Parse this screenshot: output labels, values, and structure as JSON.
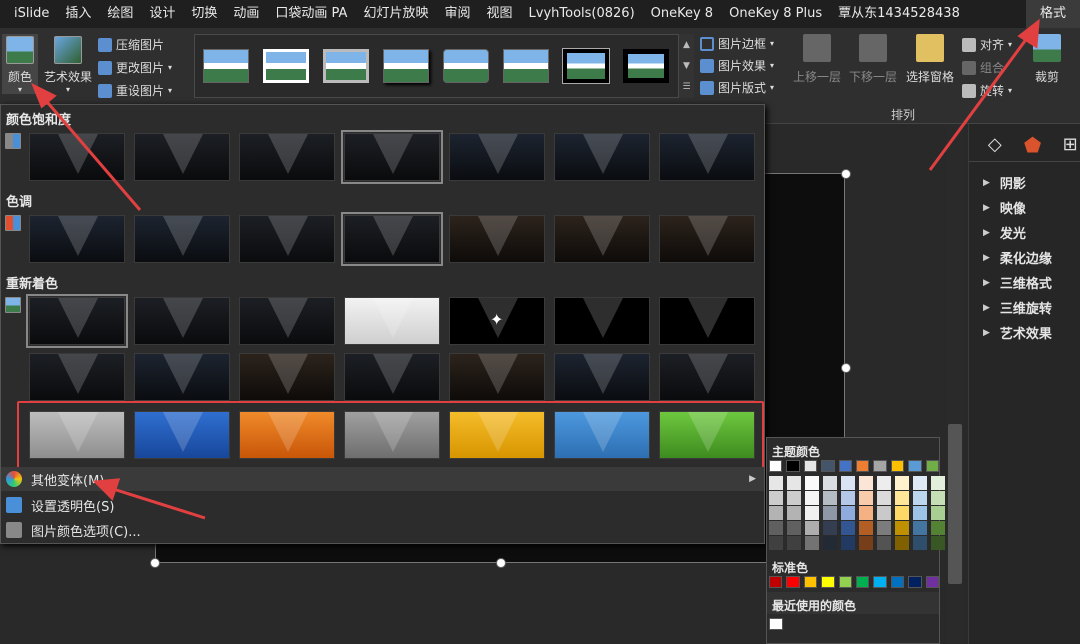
{
  "menubar": {
    "items": [
      "iSlide",
      "插入",
      "绘图",
      "设计",
      "切换",
      "动画",
      "口袋动画 PA",
      "幻灯片放映",
      "审阅",
      "视图",
      "LvyhTools(0826)",
      "OneKey 8",
      "OneKey 8 Plus",
      "覃从东1434528438"
    ],
    "active": "格式"
  },
  "ribbon": {
    "color_btn": "颜色",
    "art_effect_btn": "艺术效果",
    "compress": "压缩图片",
    "change": "更改图片",
    "reset": "重设图片",
    "border": "图片边框",
    "effect": "图片效果",
    "layout": "图片版式",
    "bring_forward": "上移一层",
    "send_backward": "下移一层",
    "selection_pane": "选择窗格",
    "align": "对齐",
    "group": "组合",
    "rotate": "旋转",
    "crop": "裁剪",
    "arrange_label": "排列"
  },
  "dropdown": {
    "saturation_title": "颜色饱和度",
    "tone_title": "色调",
    "recolor_title": "重新着色",
    "more_variations": "其他变体(M)",
    "set_transparent": "设置透明色(S)",
    "color_options": "图片颜色选项(C)..."
  },
  "picker": {
    "theme_colors": "主题颜色",
    "standard_colors": "标准色",
    "recent_colors": "最近使用的颜色",
    "theme_row": [
      "#ffffff",
      "#000000",
      "#e7e6e6",
      "#44546a",
      "#4472c4",
      "#ed7d31",
      "#a5a5a5",
      "#ffc000",
      "#5b9bd5",
      "#70ad47"
    ],
    "standard_row": [
      "#c00000",
      "#ff0000",
      "#ffc000",
      "#ffff00",
      "#92d050",
      "#00b050",
      "#00b0f0",
      "#0070c0",
      "#002060",
      "#7030a0"
    ],
    "recent_row": [
      "#ffffff"
    ]
  },
  "right_panel": {
    "items": [
      "阴影",
      "映像",
      "发光",
      "柔化边缘",
      "三维格式",
      "三维旋转",
      "艺术效果"
    ]
  },
  "colors": {
    "highlight_red": "#e24040",
    "accent_orange": "#d9532c"
  }
}
